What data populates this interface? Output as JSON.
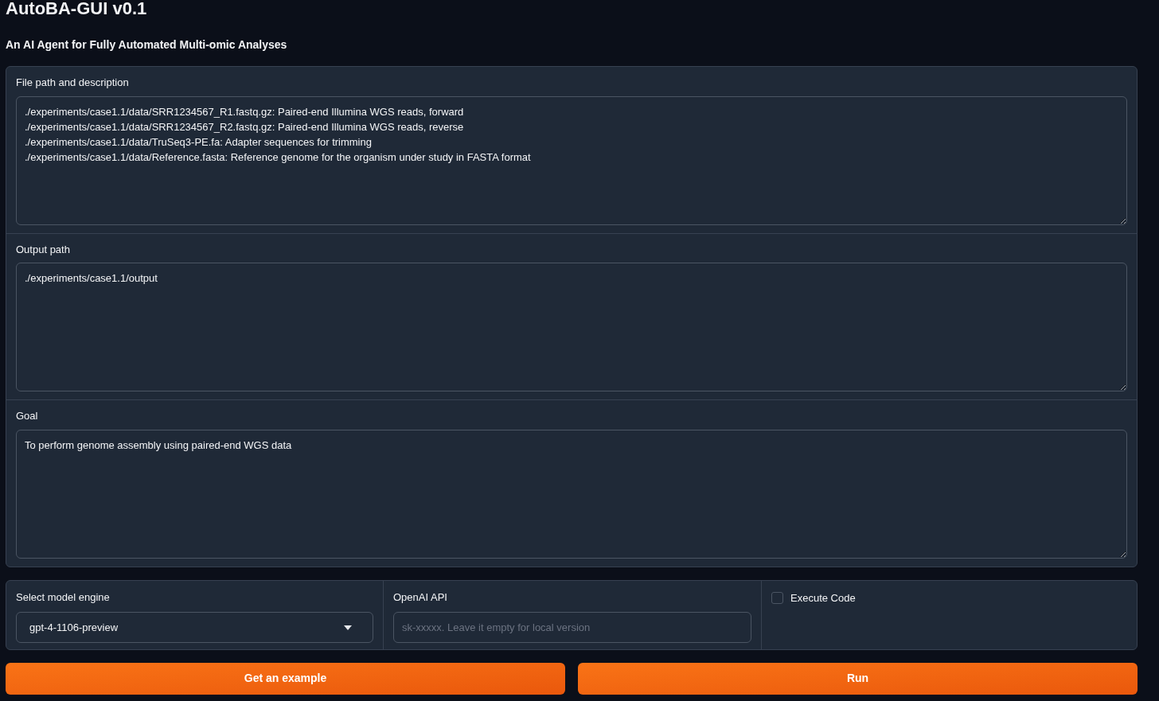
{
  "title": "AutoBA-GUI v0.1",
  "subtitle": "An AI Agent for Fully Automated Multi-omic Analyses",
  "text_fields": [
    {
      "label": "File path and description",
      "lines": [
        "./experiments/case1.1/data/SRR1234567_R1.fastq.gz: Paired-end Illumina WGS reads, forward",
        "./experiments/case1.1/data/SRR1234567_R2.fastq.gz: Paired-end Illumina WGS reads, reverse",
        "./experiments/case1.1/data/TruSeq3-PE.fa: Adapter sequences for trimming",
        "./experiments/case1.1/data/Reference.fasta: Reference genome for the organism under study in FASTA format"
      ]
    },
    {
      "label": "Output path",
      "lines": [
        "./experiments/case1.1/output"
      ]
    },
    {
      "label": "Goal",
      "lines": [
        "To perform genome assembly using paired-end WGS data"
      ]
    }
  ],
  "model_engine": {
    "label": "Select model engine",
    "value": "gpt-4-1106-preview"
  },
  "openai_api": {
    "label": "OpenAI API",
    "placeholder": "sk-xxxxx. Leave it empty for local version"
  },
  "execute_code": {
    "label": "Execute Code",
    "checked": false
  },
  "buttons": [
    "Get an example",
    "Run"
  ]
}
